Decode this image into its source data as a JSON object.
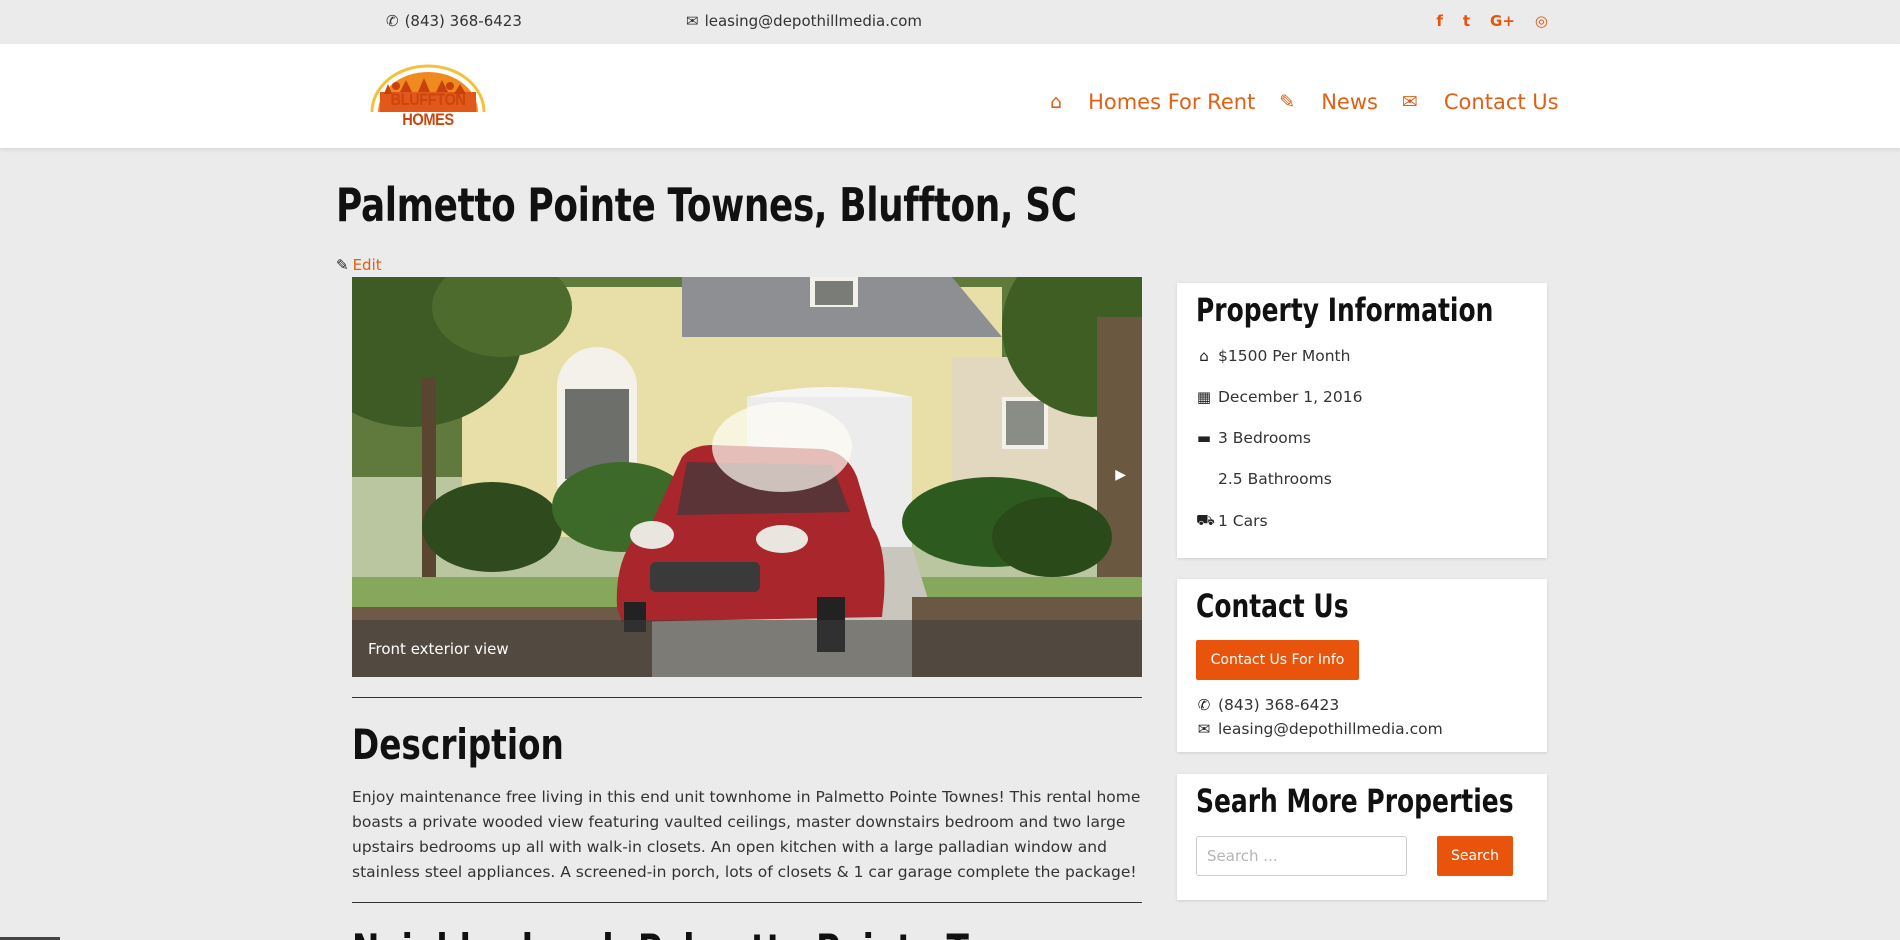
{
  "topbar": {
    "phone": "(843) 368-6423",
    "email": "leasing@depothillmedia.com",
    "social": [
      {
        "icon": "facebook-icon",
        "glyph": "f"
      },
      {
        "icon": "twitter-icon",
        "glyph": "t"
      },
      {
        "icon": "google-plus-icon",
        "glyph": "G+"
      },
      {
        "icon": "instagram-icon",
        "glyph": "◎"
      }
    ]
  },
  "header": {
    "logo_text": "BLUFFTON HOMES",
    "nav": [
      {
        "icon": "home-icon",
        "glyph": "⌂",
        "label": "Homes For Rent"
      },
      {
        "icon": "pencil-icon",
        "glyph": "✎",
        "label": "News"
      },
      {
        "icon": "envelope-icon",
        "glyph": "✉",
        "label": "Contact Us"
      }
    ]
  },
  "page": {
    "title": "Palmetto Pointe Townes, Bluffton, SC",
    "edit_label": "Edit"
  },
  "gallery": {
    "caption": "Front exterior view",
    "next_glyph": "▶"
  },
  "description": {
    "heading": "Description",
    "text": "Enjoy maintenance free living in this end unit townhome in Palmetto Pointe Townes! This rental home boasts a private wooded view featuring vaulted ceilings, master downstairs bedroom and two large upstairs bedrooms up all with walk-in closets. An open kitchen with a large palladian window and stainless steel appliances. A screened-in porch, lots of closets & 1 car garage complete the package!",
    "next_heading": "Neighborhood: Palmetto Pointe Townes"
  },
  "property_info": {
    "heading": "Property Information",
    "rent": "$1500 Per Month",
    "date": "December 1, 2016",
    "bedrooms": "3 Bedrooms",
    "bathrooms": "2.5 Bathrooms",
    "cars": "1 Cars"
  },
  "contact": {
    "heading": "Contact Us",
    "button": "Contact Us For Info",
    "phone": "(843) 368-6423",
    "email": "leasing@depothillmedia.com"
  },
  "search": {
    "heading": "Searh More Properties",
    "placeholder": "Search ...",
    "button": "Search"
  },
  "colors": {
    "accent": "#e8540c",
    "background": "#ebebeb"
  }
}
